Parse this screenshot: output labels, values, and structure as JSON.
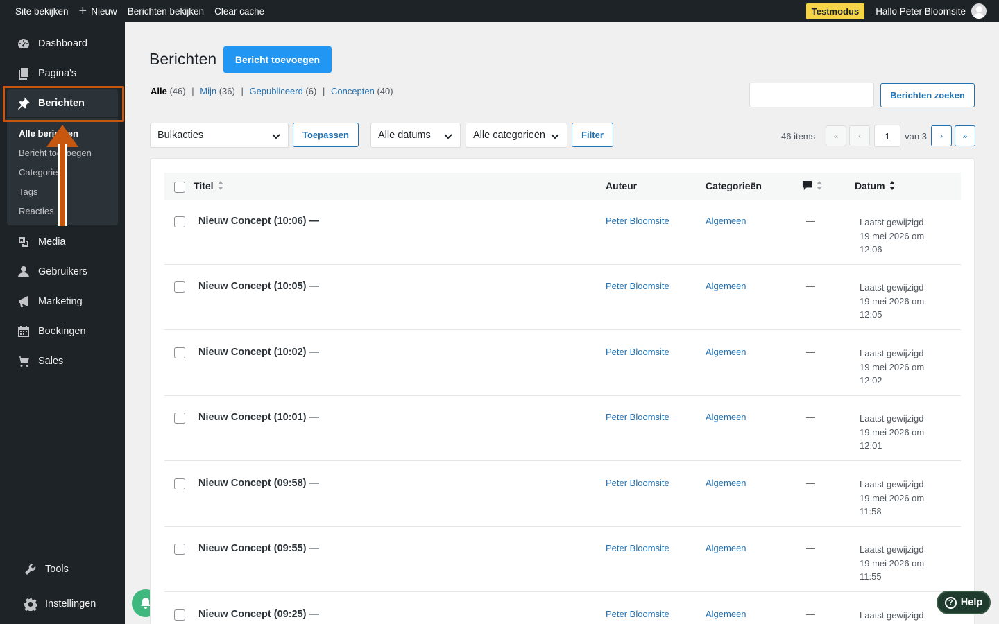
{
  "adminbar": {
    "site": "Site bekijken",
    "new": "Nieuw",
    "view_posts": "Berichten bekijken",
    "clear_cache": "Clear cache",
    "test_mode": "Testmodus",
    "greeting": "Hallo Peter Bloomsite"
  },
  "sidebar": {
    "items": [
      {
        "label": "Dashboard",
        "icon": "dashboard-icon"
      },
      {
        "label": "Pagina's",
        "icon": "pages-icon"
      },
      {
        "label": "Berichten",
        "icon": "pin-icon"
      },
      {
        "label": "Media",
        "icon": "media-icon"
      },
      {
        "label": "Gebruikers",
        "icon": "user-icon"
      },
      {
        "label": "Marketing",
        "icon": "megaphone-icon"
      },
      {
        "label": "Boekingen",
        "icon": "calendar-icon"
      },
      {
        "label": "Sales",
        "icon": "cart-icon"
      },
      {
        "label": "Tools",
        "icon": "wrench-icon"
      },
      {
        "label": "Instellingen",
        "icon": "gear-icon"
      }
    ],
    "submenu": [
      "Alle berichten",
      "Bericht toevoegen",
      "Categorieën",
      "Tags",
      "Reacties"
    ]
  },
  "page": {
    "title": "Berichten",
    "add_button": "Bericht toevoegen",
    "filters": {
      "all": "Alle",
      "all_count": "(46)",
      "mine": "Mijn",
      "mine_count": "(36)",
      "published": "Gepubliceerd",
      "published_count": "(6)",
      "drafts": "Concepten",
      "drafts_count": "(40)",
      "sep": "|"
    },
    "search_button": "Berichten zoeken",
    "bulk": "Bulkacties",
    "apply": "Toepassen",
    "dates": "Alle datums",
    "categories": "Alle categorieën",
    "filter": "Filter",
    "pagination": {
      "items": "46 items",
      "first": "«",
      "prev": "‹",
      "current": "1",
      "of": "van 3",
      "next": "›",
      "last": "»"
    }
  },
  "table": {
    "headers": {
      "title": "Titel",
      "author": "Auteur",
      "categories": "Categorieën",
      "date": "Datum"
    },
    "rows": [
      {
        "title": "Nieuw Concept (10:06) —",
        "author": "Peter Bloomsite",
        "category": "Algemeen",
        "comments": "—",
        "status": "Laatst gewijzigd",
        "date": "19 mei 2026 om",
        "time": "12:06"
      },
      {
        "title": "Nieuw Concept (10:05) —",
        "author": "Peter Bloomsite",
        "category": "Algemeen",
        "comments": "—",
        "status": "Laatst gewijzigd",
        "date": "19 mei 2026 om",
        "time": "12:05"
      },
      {
        "title": "Nieuw Concept (10:02) —",
        "author": "Peter Bloomsite",
        "category": "Algemeen",
        "comments": "—",
        "status": "Laatst gewijzigd",
        "date": "19 mei 2026 om",
        "time": "12:02"
      },
      {
        "title": "Nieuw Concept (10:01) —",
        "author": "Peter Bloomsite",
        "category": "Algemeen",
        "comments": "—",
        "status": "Laatst gewijzigd",
        "date": "19 mei 2026 om",
        "time": "12:01"
      },
      {
        "title": "Nieuw Concept (09:58) —",
        "author": "Peter Bloomsite",
        "category": "Algemeen",
        "comments": "—",
        "status": "Laatst gewijzigd",
        "date": "19 mei 2026 om",
        "time": "11:58"
      },
      {
        "title": "Nieuw Concept (09:55) —",
        "author": "Peter Bloomsite",
        "category": "Algemeen",
        "comments": "—",
        "status": "Laatst gewijzigd",
        "date": "19 mei 2026 om",
        "time": "11:55"
      },
      {
        "title": "Nieuw Concept (09:25) —",
        "author": "Peter Bloomsite",
        "category": "Algemeen",
        "comments": "—",
        "status": "Laatst gewijzigd",
        "date": "",
        "time": ""
      }
    ]
  },
  "help": "Help",
  "colors": {
    "accent": "#2196f3",
    "link": "#2271b1",
    "annotation": "#c7570e",
    "testmode": "#f5d547",
    "bell": "#3fb87f"
  }
}
